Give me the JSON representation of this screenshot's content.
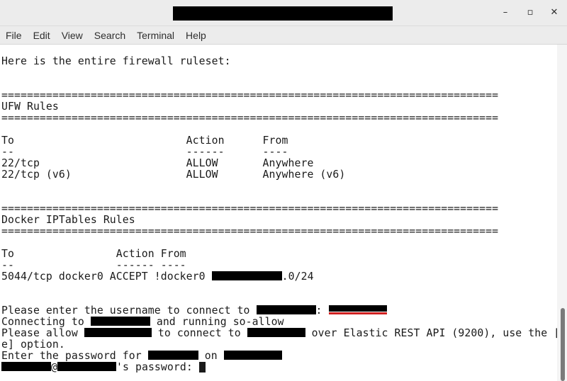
{
  "window": {
    "minimize_glyph": "–",
    "maximize_glyph": "▫",
    "close_glyph": "✕"
  },
  "menu": [
    "File",
    "Edit",
    "View",
    "Search",
    "Terminal",
    "Help"
  ],
  "terminal": {
    "intro": "Here is the entire firewall ruleset:",
    "separator": "==============================================================================",
    "ufw_heading": "UFW Rules",
    "ufw_header": "To                           Action      From",
    "ufw_dashes": "--                           ------      ----",
    "ufw_row1": "22/tcp                       ALLOW       Anywhere",
    "ufw_row2": "22/tcp (v6)                  ALLOW       Anywhere (v6)",
    "docker_heading": "Docker IPTables Rules",
    "docker_header": "To                Action From",
    "docker_dashes": "--                ------ ----",
    "docker_row_prefix": "5044/tcp docker0 ACCEPT !docker0 ",
    "docker_row_suffix": ".0/24",
    "prompt_username_prefix": "Please enter the username to connect to ",
    "prompt_username_colon": ":",
    "connecting_prefix": "Connecting to ",
    "connecting_suffix": " and running so-allow",
    "allow_prefix": "Please allow ",
    "allow_middle": " to connect to ",
    "allow_suffix": " over Elastic REST API (9200), use the [",
    "allow_cont": "e] option.",
    "password_prefix": "Enter the password for ",
    "password_middle": " on ",
    "ssh_at": "@",
    "ssh_suffix": "'s password: "
  },
  "colors": {
    "redaction": "#000000",
    "underline": "#d02020",
    "text": "#1a1a1a"
  }
}
